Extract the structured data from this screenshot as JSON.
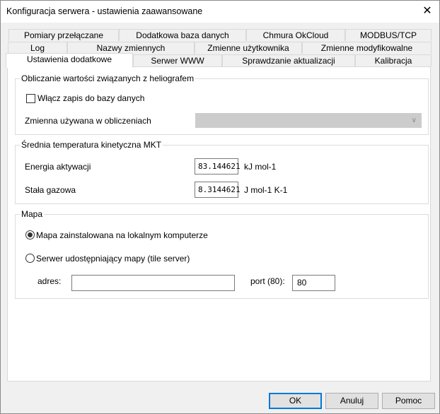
{
  "window": {
    "title": "Konfiguracja serwera - ustawienia zaawansowane",
    "close_glyph": "✕"
  },
  "tabs": {
    "row1": [
      "Pomiary przełączane",
      "Dodatkowa baza danych",
      "Chmura OkCloud",
      "MODBUS/TCP"
    ],
    "row2": [
      "Log",
      "Nazwy zmiennych",
      "Zmienne użytkownika",
      "Zmienne modyfikowalne"
    ],
    "row3": [
      "Ustawienia dodatkowe",
      "Serwer WWW",
      "Sprawdzanie aktualizacji",
      "Kalibracja"
    ],
    "active": "Ustawienia dodatkowe"
  },
  "helio": {
    "legend": "Obliczanie wartości związanych z heliografem",
    "checkbox_label": "Włącz zapis do bazy danych",
    "checkbox_checked": false,
    "variable_label": "Zmienna używana w obliczeniach",
    "variable_value": ""
  },
  "mkt": {
    "legend": "Średnia temperatura kinetyczna MKT",
    "energy_label": "Energia aktywacji",
    "energy_value": "83.144621",
    "energy_unit": "kJ mol-1",
    "gas_label": "Stała gazowa",
    "gas_value": "8.3144621",
    "gas_unit": "J mol-1 K-1"
  },
  "map": {
    "legend": "Mapa",
    "option_local": "Mapa zainstalowana na lokalnym komputerze",
    "option_server": "Serwer udostępniający mapy (tile server)",
    "selected": "local",
    "address_label": "adres:",
    "address_value": "",
    "port_label": "port (80):",
    "port_value": "80"
  },
  "buttons": {
    "ok": "OK",
    "cancel": "Anuluj",
    "help": "Pomoc"
  }
}
